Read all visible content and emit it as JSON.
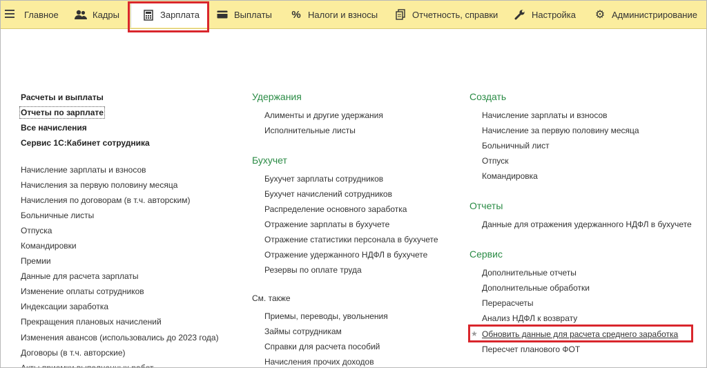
{
  "menu": {
    "tabs": [
      {
        "label": "Главное",
        "icon": "hamburger-icon"
      },
      {
        "label": "Кадры",
        "icon": "users-icon"
      },
      {
        "label": "Зарплата",
        "icon": "calculator-icon"
      },
      {
        "label": "Выплаты",
        "icon": "card-icon"
      },
      {
        "label": "Налоги и взносы",
        "icon": "percent-icon"
      },
      {
        "label": "Отчетность, справки",
        "icon": "documents-icon"
      },
      {
        "label": "Настройка",
        "icon": "wrench-icon"
      },
      {
        "label": "Администрирование",
        "icon": "gear-icon"
      }
    ],
    "active_tab": "Зарплата"
  },
  "left": {
    "bold_items": [
      "Расчеты и выплаты",
      "Отчеты по зарплате",
      "Все начисления",
      "Сервис 1С:Кабинет сотрудника"
    ],
    "items": [
      "Начисление зарплаты и взносов",
      "Начисления за первую половину месяца",
      "Начисления по договорам (в т.ч. авторским)",
      "Больничные листы",
      "Отпуска",
      "Командировки",
      "Премии",
      "Данные для расчета зарплаты",
      "Изменение оплаты сотрудников",
      "Индексации заработка",
      "Прекращения плановых начислений",
      "Изменения авансов (использовались до 2023 года)",
      "Договоры (в т.ч. авторские)",
      "Акты приемки выполненных работ"
    ]
  },
  "middle": {
    "groups": [
      {
        "title": "Удержания",
        "items": [
          "Алименты и другие удержания",
          "Исполнительные листы"
        ]
      },
      {
        "title": "Бухучет",
        "items": [
          "Бухучет зарплаты сотрудников",
          "Бухучет начислений сотрудников",
          "Распределение основного заработка",
          "Отражение зарплаты в бухучете",
          "Отражение статистики персонала в бухучете",
          "Отражение удержанного НДФЛ в бухучете",
          "Резервы по оплате труда"
        ]
      }
    ],
    "see_also": {
      "title": "См. также",
      "items": [
        "Приемы, переводы, увольнения",
        "Займы сотрудникам",
        "Справки для расчета пособий",
        "Начисления прочих доходов"
      ]
    }
  },
  "right": {
    "groups": [
      {
        "title": "Создать",
        "items": [
          "Начисление зарплаты и взносов",
          "Начисление за первую половину месяца",
          "Больничный лист",
          "Отпуск",
          "Командировка"
        ]
      },
      {
        "title": "Отчеты",
        "items": [
          "Данные для отражения удержанного НДФЛ в бухучете"
        ]
      },
      {
        "title": "Сервис",
        "items": [
          "Дополнительные отчеты",
          "Дополнительные обработки",
          "Перерасчеты",
          "Анализ НДФЛ к возврату",
          "Обновить данные для расчета среднего заработка",
          "Пересчет планового ФОТ"
        ]
      }
    ]
  },
  "colors": {
    "menu_bg": "#fbed9e",
    "heading": "#2a8b45",
    "highlight": "#d9262c"
  }
}
